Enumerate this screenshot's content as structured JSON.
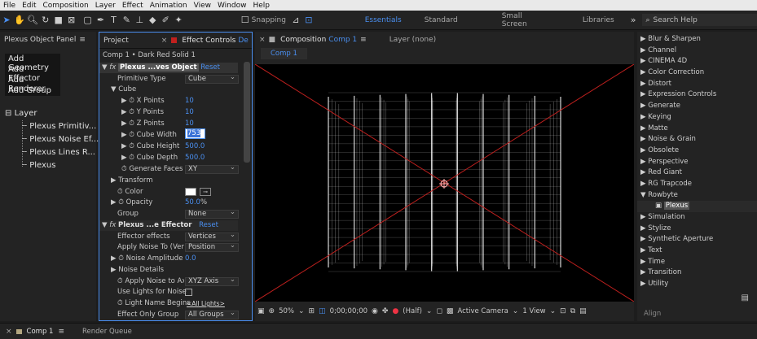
{
  "menu": [
    "File",
    "Edit",
    "Composition",
    "Layer",
    "Effect",
    "Animation",
    "View",
    "Window",
    "Help"
  ],
  "toolbar": {
    "snapping": "Snapping",
    "workspaces": [
      "Essentials",
      "Standard",
      "Small Screen",
      "Libraries"
    ],
    "search_placeholder": "Search Help",
    "overflow": "»"
  },
  "plexus_panel": {
    "title": "Plexus Object Panel",
    "buttons": [
      "Add Geometry",
      "Add Effector",
      "Add Renderer",
      "Add Group"
    ],
    "tree_root": "Layer",
    "tree_items": [
      "Plexus Primitiv...",
      "Plexus Noise Ef...",
      "Plexus Lines R...",
      "Plexus"
    ]
  },
  "effect_controls": {
    "tab_project": "Project",
    "tab_ec": "Effect Controls",
    "tab_ec_suffix": "De",
    "breadcrumb": "Comp 1 • Dark Red Solid 1",
    "fx1": {
      "name": "Plexus ...ves Object",
      "reset": "Reset"
    },
    "primitive_type": {
      "label": "Primitive Type",
      "value": "Cube"
    },
    "cube": "Cube",
    "x_points": {
      "label": "X Points",
      "value": "10"
    },
    "y_points": {
      "label": "Y Points",
      "value": "10"
    },
    "z_points": {
      "label": "Z Points",
      "value": "10"
    },
    "cube_width": {
      "label": "Cube Width",
      "value": "753"
    },
    "cube_height": {
      "label": "Cube Height",
      "value": "500.0"
    },
    "cube_depth": {
      "label": "Cube Depth",
      "value": "500.0"
    },
    "generate_faces": {
      "label": "Generate Faces",
      "value": "XY"
    },
    "transform": "Transform",
    "color": "Color",
    "opacity": {
      "label": "Opacity",
      "value": "50.0",
      "unit": "%"
    },
    "group": {
      "label": "Group",
      "value": "None"
    },
    "fx2": {
      "name": "Plexus ...e Effector",
      "reset": "Reset"
    },
    "effector_effects": {
      "label": "Effector effects",
      "value": "Vertices"
    },
    "apply_noise_to": {
      "label": "Apply Noise To (Verti",
      "value": "Position"
    },
    "noise_amplitude": {
      "label": "Noise Amplitude",
      "value": "0.0"
    },
    "noise_details": "Noise Details",
    "apply_noise_axis": {
      "label": "Apply Noise to Axi",
      "value": "XYZ Axis"
    },
    "use_lights": "Use Lights for Noise",
    "light_name": {
      "label": "Light Name Begins",
      "value": "<All Lights>"
    },
    "effect_only_group": {
      "label": "Effect Only Group",
      "value": "All Groups"
    }
  },
  "composition": {
    "tab": "Composition",
    "comp_name": "Comp 1",
    "layer_tab": "Layer (none)",
    "subtab": "Comp 1",
    "bottom": {
      "zoom": "50%",
      "timecode": "0;00;00;00",
      "resolution": "(Half)",
      "camera": "Active Camera",
      "views": "1 View"
    }
  },
  "fx_presets": {
    "items": [
      "Blur & Sharpen",
      "Channel",
      "CINEMA 4D",
      "Color Correction",
      "Distort",
      "Expression Controls",
      "Generate",
      "Keying",
      "Matte",
      "Noise & Grain",
      "Obsolete",
      "Perspective",
      "Red Giant",
      "RG Trapcode",
      "Rowbyte",
      "Plexus",
      "Simulation",
      "Stylize",
      "Synthetic Aperture",
      "Text",
      "Time",
      "Transition",
      "Utility"
    ],
    "align": "Align"
  },
  "timeline": {
    "comp_tab": "Comp 1",
    "render_queue": "Render Queue"
  },
  "colors": {
    "accent": "#4a8ff0",
    "bg": "#1d1d1d",
    "panel": "#232323",
    "line": "#c0201e"
  }
}
